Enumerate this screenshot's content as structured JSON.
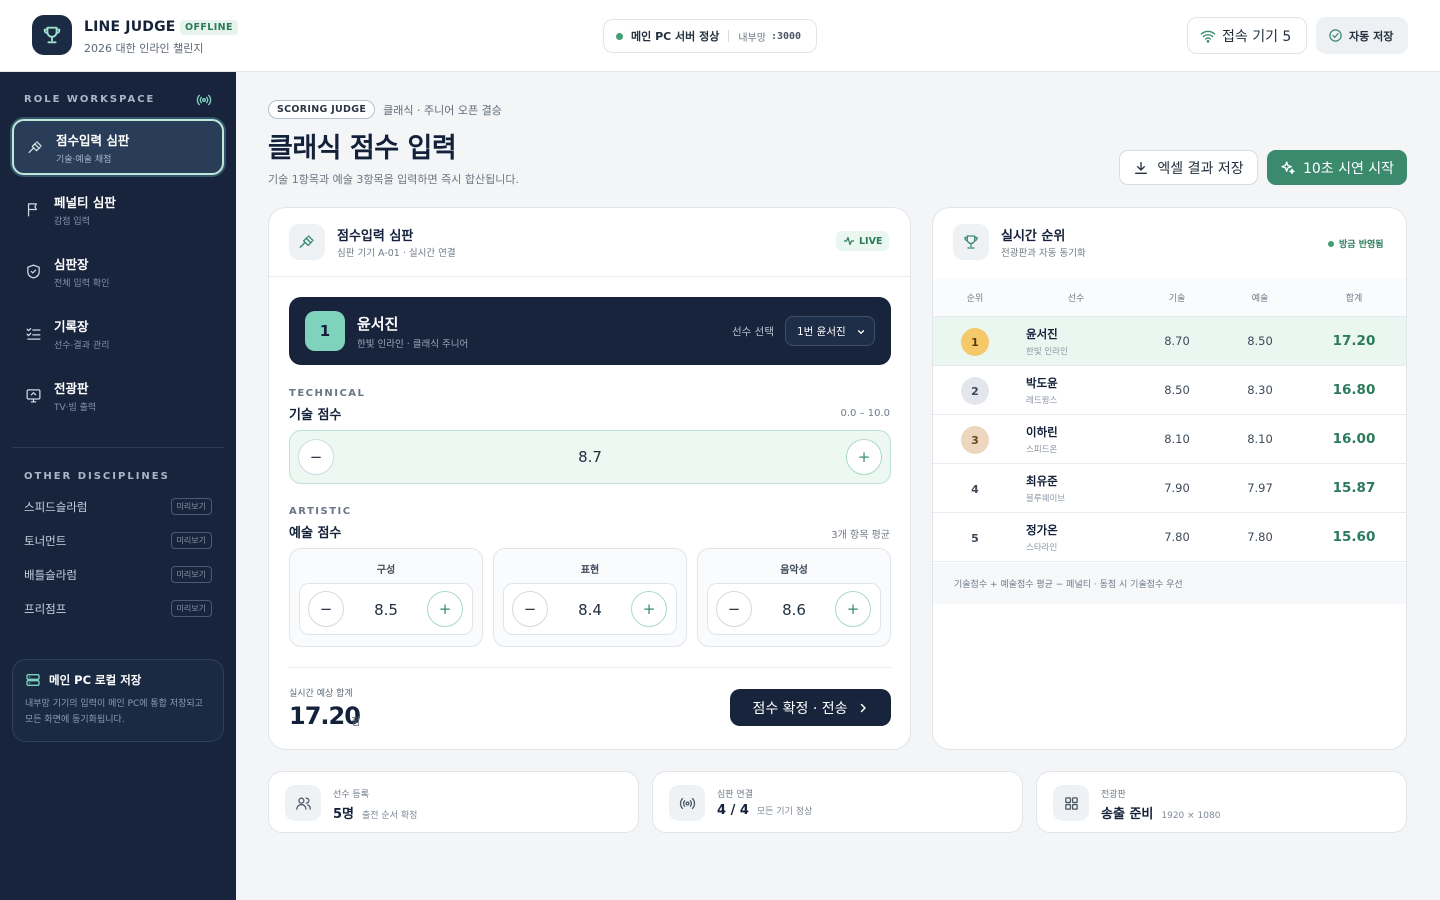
{
  "header": {
    "brand": "LINE JUDGE",
    "status_badge": "OFFLINE",
    "event": "2026 대한 인라인 챌린지",
    "server": {
      "label": "메인 PC 서버 정상",
      "network": "내부망",
      "port": ":3000"
    },
    "devices": "접속 기기 5",
    "autosave": "자동 저장"
  },
  "sidebar": {
    "heading": "ROLE WORKSPACE",
    "roles": [
      {
        "label": "점수입력 심판",
        "sub": "기술·예술 채점",
        "icon": "gavel-icon",
        "active": true
      },
      {
        "label": "페널티 심판",
        "sub": "감점 입력",
        "icon": "flag-icon",
        "active": false
      },
      {
        "label": "심판장",
        "sub": "전체 입력 확인",
        "icon": "shield-check-icon",
        "active": false
      },
      {
        "label": "기록장",
        "sub": "선수·결과 관리",
        "icon": "checklist-icon",
        "active": false
      },
      {
        "label": "전광판",
        "sub": "TV·빔 출력",
        "icon": "monitor-icon",
        "active": false
      }
    ],
    "other_heading": "OTHER DISCIPLINES",
    "disciplines": [
      {
        "label": "스피드슬라럼",
        "badge": "미리보기"
      },
      {
        "label": "토너먼트",
        "badge": "미리보기"
      },
      {
        "label": "배틀슬라럼",
        "badge": "미리보기"
      },
      {
        "label": "프리점프",
        "badge": "미리보기"
      }
    ],
    "local": {
      "title": "메인 PC 로컬 저장",
      "desc": "내부망 기기의 입력이 메인 PC에 통합 저장되고 모든 화면에 동기화됩니다."
    }
  },
  "page": {
    "badge": "SCORING JUDGE",
    "breadcrumb": "클래식 · 주니어 오픈 결승",
    "title": "클래식 점수 입력",
    "subtitle": "기술 1항목과 예술 3항목을 입력하면 즉시 합산됩니다.",
    "excel_button": "엑셀 결과 저장",
    "demo_button": "10초 시연 시작"
  },
  "input_card": {
    "title": "점수입력 심판",
    "sub": "심판 기기 A-01 · 실시간 연결",
    "live": "LIVE",
    "player": {
      "number": "1",
      "name": "윤서진",
      "team": "한빛 인라인 · 클래식 주니어",
      "select_label": "선수 선택",
      "select_value": "1번 윤서진"
    },
    "technical": {
      "label_en": "TECHNICAL",
      "label": "기술 점수",
      "range": "0.0 – 10.0",
      "value": "8.7"
    },
    "artistic": {
      "label_en": "ARTISTIC",
      "label": "예술 점수",
      "note": "3개 항목 평균",
      "items": [
        {
          "name": "구성",
          "value": "8.5"
        },
        {
          "name": "표현",
          "value": "8.4"
        },
        {
          "name": "음악성",
          "value": "8.6"
        }
      ]
    },
    "total": {
      "label": "실시간 예상 합계",
      "value": "17.20",
      "unit": "점"
    },
    "confirm_button": "점수 확정 · 전송"
  },
  "ranking": {
    "title": "실시간 순위",
    "sub": "전광판과 자동 동기화",
    "updated": "방금 반영됨",
    "columns": [
      "순위",
      "선수",
      "기술",
      "예술",
      "합계"
    ],
    "rows": [
      {
        "rank": "1",
        "name": "윤서진",
        "team": "한빛 인라인",
        "tech": "8.70",
        "art": "8.50",
        "total": "17.20"
      },
      {
        "rank": "2",
        "name": "박도윤",
        "team": "레드윙스",
        "tech": "8.50",
        "art": "8.30",
        "total": "16.80"
      },
      {
        "rank": "3",
        "name": "이하린",
        "team": "스피드온",
        "tech": "8.10",
        "art": "8.10",
        "total": "16.00"
      },
      {
        "rank": "4",
        "name": "최유준",
        "team": "블루웨이브",
        "tech": "7.90",
        "art": "7.97",
        "total": "15.87"
      },
      {
        "rank": "5",
        "name": "정가온",
        "team": "스타라인",
        "tech": "7.80",
        "art": "7.80",
        "total": "15.60"
      }
    ],
    "footnote": "기술점수 + 예술점수 평균 − 페널티 · 동점 시 기술점수 우선"
  },
  "stats": [
    {
      "label": "선수 등록",
      "value": "5명",
      "note": "출전 순서 확정",
      "icon": "users-icon"
    },
    {
      "label": "심판 연결",
      "value": "4 / 4",
      "note": "모든 기기 정상",
      "icon": "broadcast-icon"
    },
    {
      "label": "전광판",
      "value": "송출 준비",
      "note": "1920 × 1080",
      "icon": "grid-icon"
    }
  ],
  "colors": {
    "accent": "#3b8a6e",
    "navy": "#17243c",
    "mint": "#7fd3bd",
    "gold": "#f5c86a"
  }
}
